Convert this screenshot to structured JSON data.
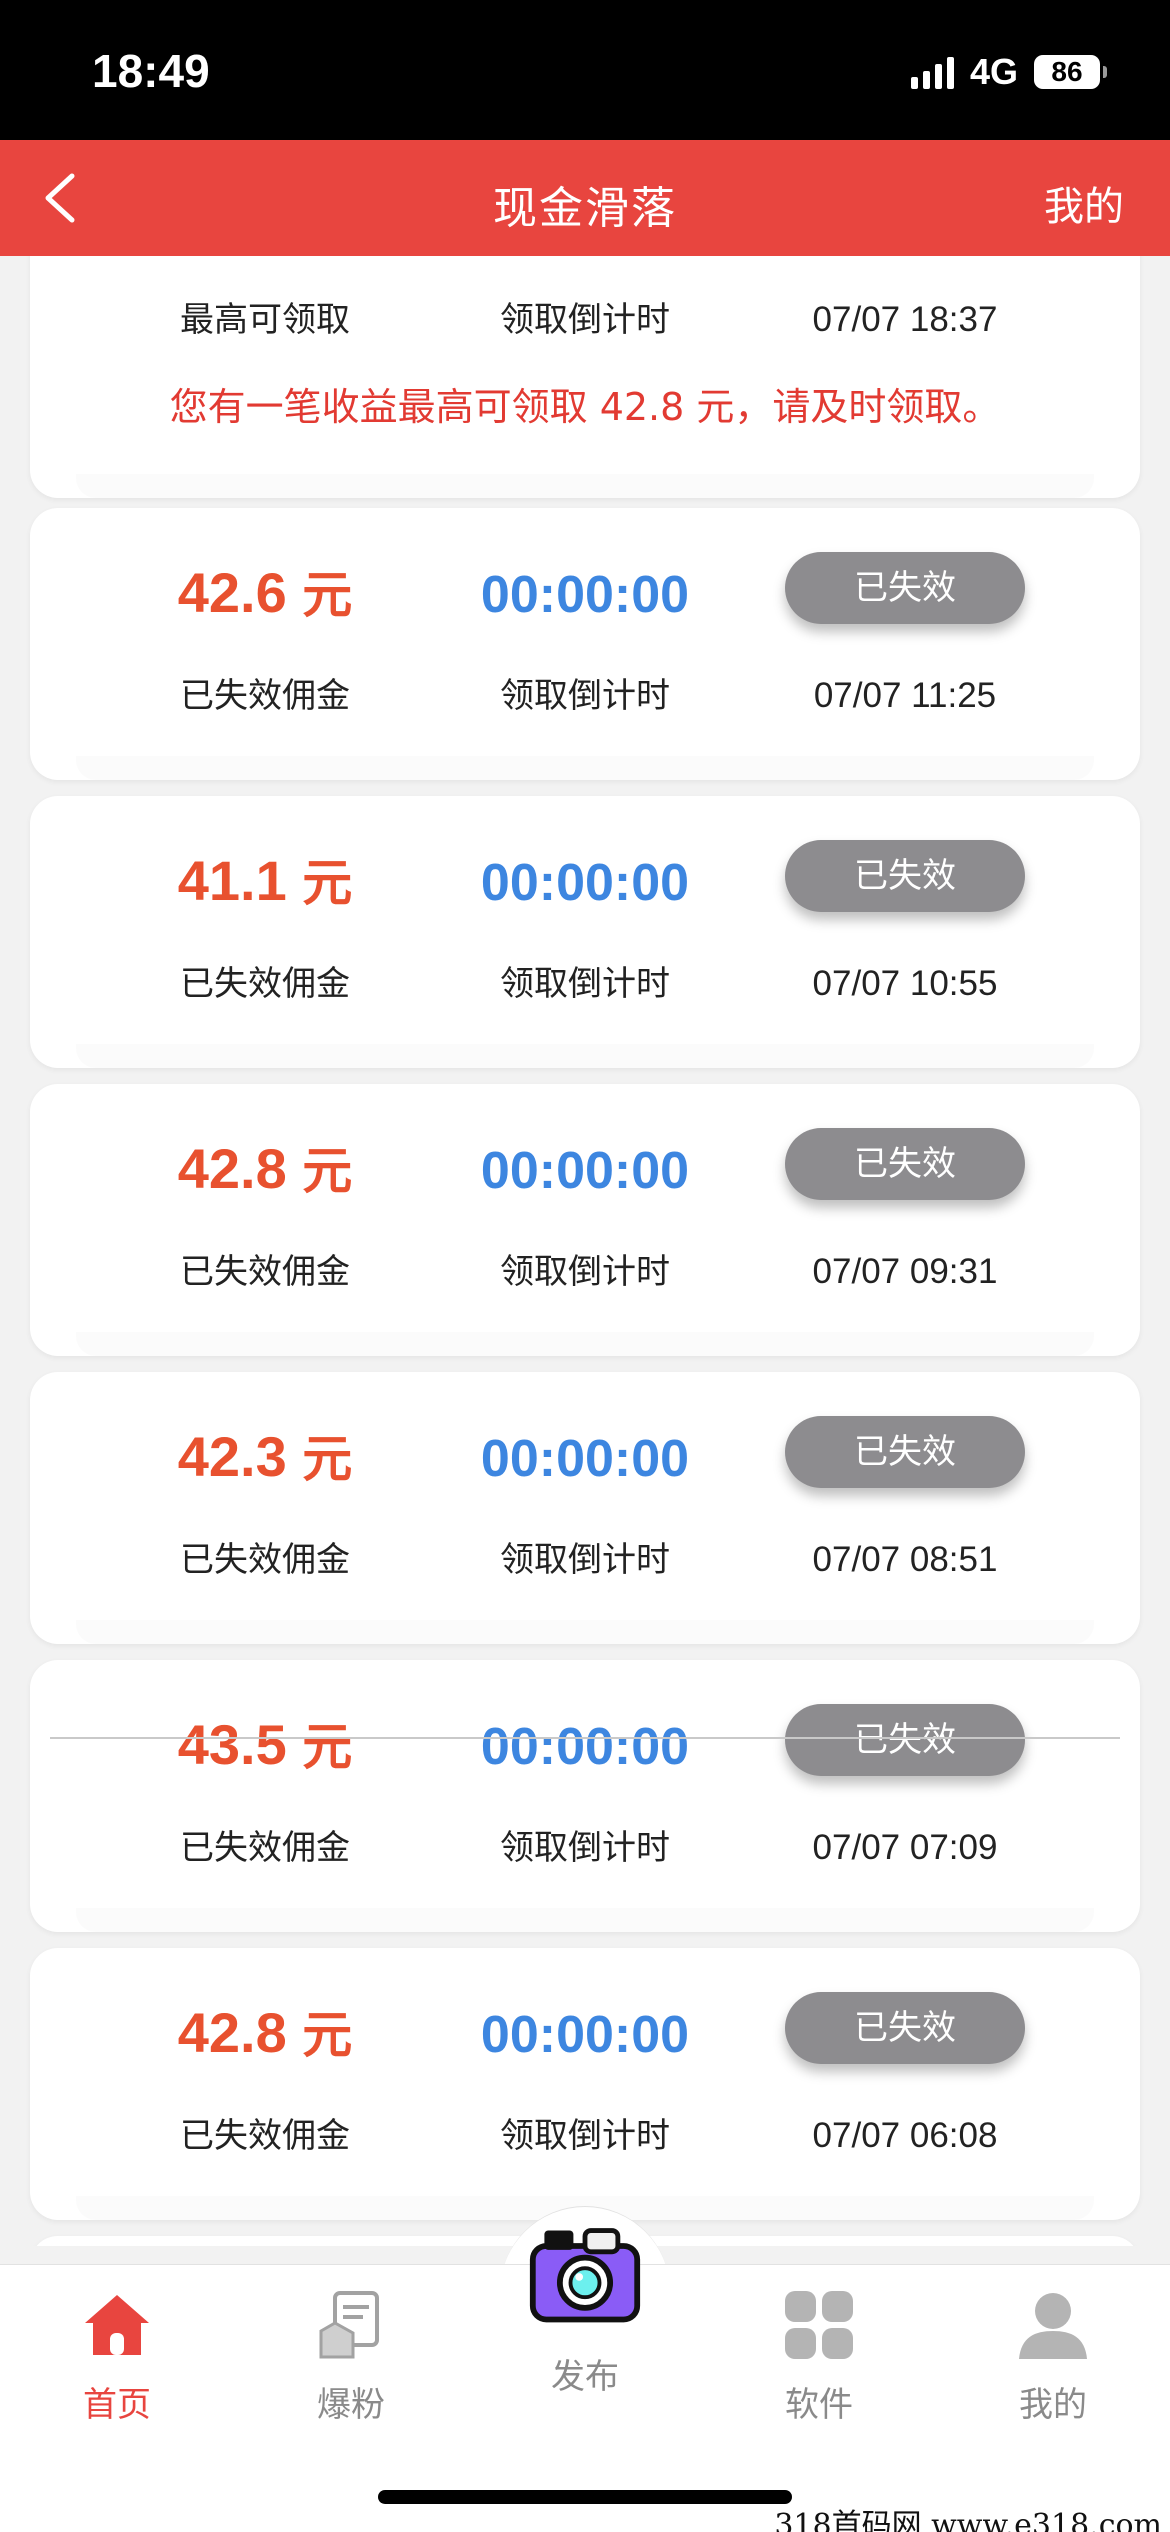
{
  "status": {
    "time": "18:49",
    "network": "4G",
    "battery": "86"
  },
  "nav": {
    "title": "现金滑落",
    "right": "我的"
  },
  "top_card": {
    "labels": [
      "最高可领取",
      "领取倒计时",
      "07/07 18:37"
    ],
    "notice": "您有一笔收益最高可领取 42.8 元，请及时领取。"
  },
  "items": [
    {
      "amount": "42.6",
      "unit": "元",
      "countdown": "00:00:00",
      "button": "已失效",
      "label": "已失效佣金",
      "countdown_label": "领取倒计时",
      "time": "07/07 11:25"
    },
    {
      "amount": "41.1",
      "unit": "元",
      "countdown": "00:00:00",
      "button": "已失效",
      "label": "已失效佣金",
      "countdown_label": "领取倒计时",
      "time": "07/07 10:55"
    },
    {
      "amount": "42.8",
      "unit": "元",
      "countdown": "00:00:00",
      "button": "已失效",
      "label": "已失效佣金",
      "countdown_label": "领取倒计时",
      "time": "07/07 09:31"
    },
    {
      "amount": "42.3",
      "unit": "元",
      "countdown": "00:00:00",
      "button": "已失效",
      "label": "已失效佣金",
      "countdown_label": "领取倒计时",
      "time": "07/07 08:51"
    },
    {
      "amount": "43.5",
      "unit": "元",
      "countdown": "00:00:00",
      "button": "已失效",
      "label": "已失效佣金",
      "countdown_label": "领取倒计时",
      "time": "07/07 07:09"
    },
    {
      "amount": "42.8",
      "unit": "元",
      "countdown": "00:00:00",
      "button": "已失效",
      "label": "已失效佣金",
      "countdown_label": "领取倒计时",
      "time": "07/07 06:08"
    }
  ],
  "tabs": [
    {
      "label": "首页",
      "icon": "home-icon",
      "active": true
    },
    {
      "label": "爆粉",
      "icon": "contacts-icon",
      "active": false
    },
    {
      "label": "发布",
      "icon": "camera-icon",
      "active": false
    },
    {
      "label": "软件",
      "icon": "apps-icon",
      "active": false
    },
    {
      "label": "我的",
      "icon": "user-icon",
      "active": false
    }
  ],
  "watermark": "318首码网 www.e318.com",
  "colors": {
    "accent": "#e8453f",
    "amount": "#e8512f",
    "countdown": "#3d86e0",
    "expired_button": "#8d8c8f"
  }
}
